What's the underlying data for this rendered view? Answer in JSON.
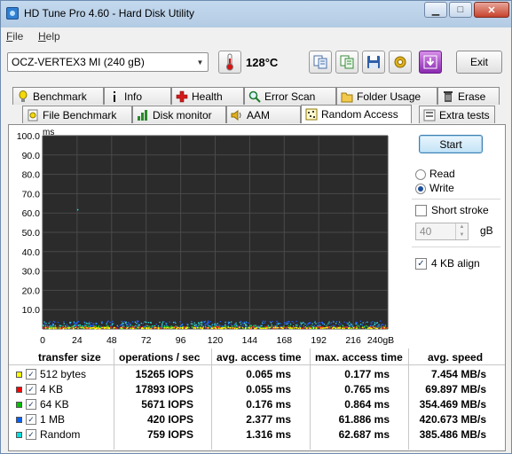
{
  "window": {
    "title": "HD Tune Pro 4.60 - Hard Disk Utility",
    "minimize_symbol": "▁",
    "maximize_symbol": "□",
    "close_symbol": "✕"
  },
  "menu": [
    "File",
    "Help"
  ],
  "toolbar": {
    "drive": "OCZ-VERTEX3 MI (240 gB)",
    "temperature": "128°C",
    "exit_label": "Exit"
  },
  "tabs_row1": [
    {
      "label": "Benchmark",
      "icon": "benchmark-icon"
    },
    {
      "label": "Info",
      "icon": "info-icon"
    },
    {
      "label": "Health",
      "icon": "health-icon"
    },
    {
      "label": "Error Scan",
      "icon": "error-scan-icon"
    },
    {
      "label": "Folder Usage",
      "icon": "folder-icon"
    },
    {
      "label": "Erase",
      "icon": "erase-icon"
    }
  ],
  "tabs_row2": [
    {
      "label": "File Benchmark",
      "icon": "file-benchmark-icon"
    },
    {
      "label": "Disk monitor",
      "icon": "disk-monitor-icon"
    },
    {
      "label": "AAM",
      "icon": "aam-icon"
    },
    {
      "label": "Random Access",
      "icon": "random-access-icon",
      "active": true
    },
    {
      "label": "Extra tests",
      "icon": "extra-tests-icon"
    }
  ],
  "controls": {
    "start_label": "Start",
    "read_label": "Read",
    "write_label": "Write",
    "mode": "Write",
    "short_stroke_label": "Short stroke",
    "short_stroke_checked": false,
    "short_stroke_value": "40",
    "short_stroke_unit": "gB",
    "align_label": "4 KB align",
    "align_checked": true
  },
  "chart_data": {
    "type": "scatter",
    "ylabel": "ms",
    "xlabel": "",
    "ylim": [
      0,
      100
    ],
    "xlim": [
      0,
      240
    ],
    "y_ticks": [
      "100.0",
      "90.0",
      "80.0",
      "70.0",
      "60.0",
      "50.0",
      "40.0",
      "30.0",
      "20.0",
      "10.0"
    ],
    "x_ticks": [
      "0",
      "24",
      "48",
      "72",
      "96",
      "120",
      "144",
      "168",
      "192",
      "216",
      "240gB"
    ],
    "grid": true,
    "background": "#2b2b2b",
    "series": [
      {
        "name": "512 bytes",
        "color": "#ffff00",
        "band_ms": [
          0,
          0.6
        ]
      },
      {
        "name": "4 KB",
        "color": "#ff2020",
        "band_ms": [
          0,
          1.0
        ]
      },
      {
        "name": "64 KB",
        "color": "#20c020",
        "band_ms": [
          0,
          1.5
        ]
      },
      {
        "name": "1 MB",
        "color": "#2060ff",
        "band_ms": [
          0.5,
          4.0
        ]
      },
      {
        "name": "Random",
        "color": "#30e0e0",
        "band_ms": [
          0.3,
          3.5
        ]
      }
    ],
    "outliers": [
      {
        "x_gb": 24,
        "y_ms": 62
      }
    ]
  },
  "results": {
    "headers": [
      "transfer size",
      "operations / sec",
      "avg. access time",
      "max. access time",
      "avg. speed"
    ],
    "rows": [
      {
        "size": "512 bytes",
        "color": "#ffff00",
        "ops": "15265 IOPS",
        "avg": "0.065 ms",
        "max": "0.177 ms",
        "speed": "7.454 MB/s"
      },
      {
        "size": "4 KB",
        "color": "#ff0000",
        "ops": "17893 IOPS",
        "avg": "0.055 ms",
        "max": "0.765 ms",
        "speed": "69.897 MB/s"
      },
      {
        "size": "64 KB",
        "color": "#00c000",
        "ops": "5671 IOPS",
        "avg": "0.176 ms",
        "max": "0.864 ms",
        "speed": "354.469 MB/s"
      },
      {
        "size": "1 MB",
        "color": "#0060ff",
        "ops": "420 IOPS",
        "avg": "2.377 ms",
        "max": "61.886 ms",
        "speed": "420.673 MB/s"
      },
      {
        "size": "Random",
        "color": "#00e0e0",
        "ops": "759 IOPS",
        "avg": "1.316 ms",
        "max": "62.687 ms",
        "speed": "385.486 MB/s"
      }
    ]
  }
}
